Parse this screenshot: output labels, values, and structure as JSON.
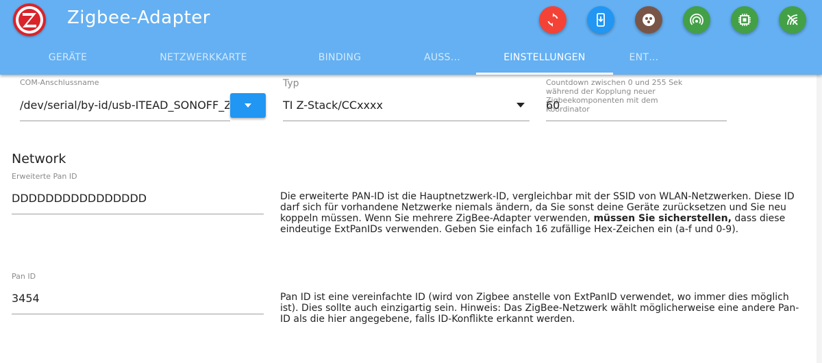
{
  "app": {
    "title": "Zigbee-Adapter"
  },
  "toolbar": [
    {
      "name": "sync-button",
      "color": "#f44336",
      "icon": "sync-icon"
    },
    {
      "name": "download-button",
      "color": "#2196f3",
      "icon": "phone-download-icon"
    },
    {
      "name": "network-button",
      "color": "#795548",
      "icon": "dots-circle-icon"
    },
    {
      "name": "signal-button",
      "color": "#43a047",
      "icon": "radio-signal-icon"
    },
    {
      "name": "chip-button",
      "color": "#43a047",
      "icon": "chip-icon"
    },
    {
      "name": "wifi-off-button",
      "color": "#43a047",
      "icon": "wifi-off-icon"
    }
  ],
  "tabs": [
    {
      "label": "Geräte"
    },
    {
      "label": "Netzwerkkarte"
    },
    {
      "label": "Binding"
    },
    {
      "label": "Auss…"
    },
    {
      "label": "Einstellungen",
      "active": true
    },
    {
      "label": "Ent…"
    }
  ],
  "com": {
    "label": "COM-Anschlussname",
    "value": "/dev/serial/by-id/usb-ITEAD_SONOFF_Zigbee"
  },
  "typ": {
    "label": "Typ",
    "value": "TI Z-Stack/CCxxxx"
  },
  "countdown": {
    "help": "Countdown zwischen 0 und 255 Sek während der Kopplung neuer Zigbeekomponenten mit dem Koordinator",
    "value": "60"
  },
  "network": {
    "heading": "Network",
    "extpanid": {
      "label": "Erweiterte Pan ID",
      "value": "DDDDDDDDDDDDDDDD",
      "desc_pre": "Die erweiterte PAN-ID ist die Hauptnetzwerk-ID, vergleichbar mit der SSID von WLAN-Netzwerken. Diese ID darf sich für vorhandene Netzwerke niemals ändern, da Sie sonst deine Geräte zurücksetzen und Sie neu koppeln müssen. Wenn Sie mehrere ZigBee-Adapter verwenden, ",
      "desc_bold": "müssen Sie sicherstellen,",
      "desc_post": " dass diese eindeutige ExtPanIDs verwenden. Geben Sie einfach 16 zufällige Hex-Zeichen ein (a-f und 0-9)."
    },
    "panid": {
      "label": "Pan ID",
      "value": "3454",
      "desc": "Pan ID ist eine vereinfachte ID (wird von Zigbee anstelle von ExtPanID verwendet, wo immer dies möglich ist). Dies sollte auch einzigartig sein. Hinweis: Das ZigBee-Netzwerk wählt möglicherweise eine andere Pan-ID als die hier angegebene, falls ID-Konflikte erkannt werden."
    }
  }
}
